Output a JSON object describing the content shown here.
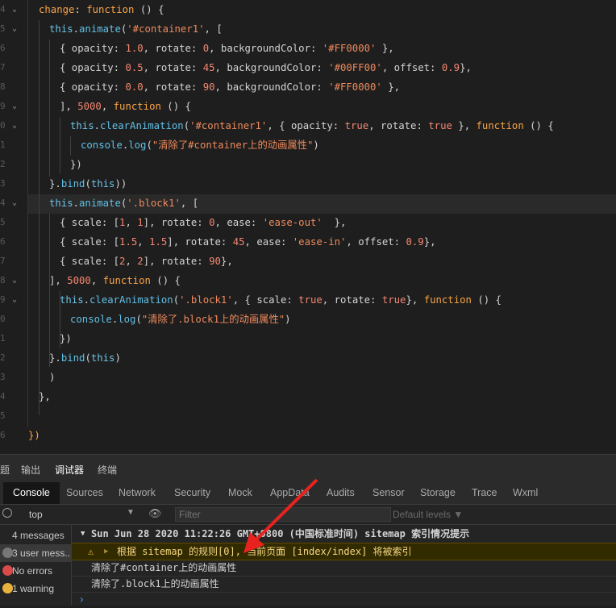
{
  "editor": {
    "lines": [
      {
        "num": "4",
        "fold": "v",
        "tokens": [
          [
            "kw",
            "change"
          ],
          [
            "p",
            ": "
          ],
          [
            "kw",
            "function"
          ],
          [
            "p",
            " () {"
          ]
        ]
      },
      {
        "num": "5",
        "fold": "v",
        "tokens": [
          [
            "th",
            "this"
          ],
          [
            "p",
            "."
          ],
          [
            "fn",
            "animate"
          ],
          [
            "p",
            "("
          ],
          [
            "str",
            "'#container1'"
          ],
          [
            "p",
            ", ["
          ]
        ]
      },
      {
        "num": "6",
        "fold": "",
        "tokens": [
          [
            "p",
            "{ opacity: "
          ],
          [
            "num",
            "1.0"
          ],
          [
            "p",
            ", rotate: "
          ],
          [
            "num",
            "0"
          ],
          [
            "p",
            ", backgroundColor: "
          ],
          [
            "str",
            "'#FF0000'"
          ],
          [
            "p",
            " },"
          ]
        ]
      },
      {
        "num": "7",
        "fold": "",
        "tokens": [
          [
            "p",
            "{ opacity: "
          ],
          [
            "num",
            "0.5"
          ],
          [
            "p",
            ", rotate: "
          ],
          [
            "num",
            "45"
          ],
          [
            "p",
            ", backgroundColor: "
          ],
          [
            "str",
            "'#00FF00'"
          ],
          [
            "p",
            ", offset: "
          ],
          [
            "num",
            "0.9"
          ],
          [
            "p",
            "},"
          ]
        ]
      },
      {
        "num": "8",
        "fold": "",
        "tokens": [
          [
            "p",
            "{ opacity: "
          ],
          [
            "num",
            "0.0"
          ],
          [
            "p",
            ", rotate: "
          ],
          [
            "num",
            "90"
          ],
          [
            "p",
            ", backgroundColor: "
          ],
          [
            "str",
            "'#FF0000'"
          ],
          [
            "p",
            " },"
          ]
        ]
      },
      {
        "num": "9",
        "fold": "v",
        "tokens": [
          [
            "p",
            "], "
          ],
          [
            "num",
            "5000"
          ],
          [
            "p",
            ", "
          ],
          [
            "kw",
            "function"
          ],
          [
            "p",
            " () {"
          ]
        ]
      },
      {
        "num": "0",
        "fold": "v",
        "tokens": [
          [
            "th",
            "this"
          ],
          [
            "p",
            "."
          ],
          [
            "fn",
            "clearAnimation"
          ],
          [
            "p",
            "("
          ],
          [
            "str",
            "'#container1'"
          ],
          [
            "p",
            ", { opacity: "
          ],
          [
            "bool",
            "true"
          ],
          [
            "p",
            ", rotate: "
          ],
          [
            "bool",
            "true"
          ],
          [
            "p",
            " }, "
          ],
          [
            "kw",
            "function"
          ],
          [
            "p",
            " () {"
          ]
        ]
      },
      {
        "num": "1",
        "fold": "",
        "tokens": [
          [
            "fn",
            "console"
          ],
          [
            "p",
            "."
          ],
          [
            "fn",
            "log"
          ],
          [
            "p",
            "("
          ],
          [
            "str",
            "\"清除了#container上的动画属性\""
          ],
          [
            "p",
            ")"
          ]
        ]
      },
      {
        "num": "2",
        "fold": "",
        "tokens": [
          [
            "p",
            "})"
          ]
        ]
      },
      {
        "num": "3",
        "fold": "",
        "tokens": [
          [
            "p",
            "}."
          ],
          [
            "fn",
            "bind"
          ],
          [
            "p",
            "("
          ],
          [
            "th",
            "this"
          ],
          [
            "p",
            "))"
          ]
        ]
      },
      {
        "num": "4",
        "fold": "v",
        "tokens": [
          [
            "th",
            "this"
          ],
          [
            "p",
            "."
          ],
          [
            "fn",
            "animate"
          ],
          [
            "p",
            "("
          ],
          [
            "str",
            "'.block1'"
          ],
          [
            "p",
            ", ["
          ]
        ]
      },
      {
        "num": "5",
        "fold": "",
        "tokens": [
          [
            "p",
            "{ scale: ["
          ],
          [
            "num",
            "1"
          ],
          [
            "p",
            ", "
          ],
          [
            "num",
            "1"
          ],
          [
            "p",
            "], rotate: "
          ],
          [
            "num",
            "0"
          ],
          [
            "p",
            ", ease: "
          ],
          [
            "str",
            "'ease-out'"
          ],
          [
            "p",
            "  },"
          ]
        ]
      },
      {
        "num": "6",
        "fold": "",
        "tokens": [
          [
            "p",
            "{ scale: ["
          ],
          [
            "num",
            "1.5"
          ],
          [
            "p",
            ", "
          ],
          [
            "num",
            "1.5"
          ],
          [
            "p",
            "], rotate: "
          ],
          [
            "num",
            "45"
          ],
          [
            "p",
            ", ease: "
          ],
          [
            "str",
            "'ease-in'"
          ],
          [
            "p",
            ", offset: "
          ],
          [
            "num",
            "0.9"
          ],
          [
            "p",
            "},"
          ]
        ]
      },
      {
        "num": "7",
        "fold": "",
        "tokens": [
          [
            "p",
            "{ scale: ["
          ],
          [
            "num",
            "2"
          ],
          [
            "p",
            ", "
          ],
          [
            "num",
            "2"
          ],
          [
            "p",
            "], rotate: "
          ],
          [
            "num",
            "90"
          ],
          [
            "p",
            "},"
          ]
        ]
      },
      {
        "num": "8",
        "fold": "v",
        "tokens": [
          [
            "p",
            "], "
          ],
          [
            "num",
            "5000"
          ],
          [
            "p",
            ", "
          ],
          [
            "kw",
            "function"
          ],
          [
            "p",
            " () {"
          ]
        ]
      },
      {
        "num": "9",
        "fold": "v",
        "tokens": [
          [
            "th",
            "this"
          ],
          [
            "p",
            "."
          ],
          [
            "fn",
            "clearAnimation"
          ],
          [
            "p",
            "("
          ],
          [
            "str",
            "'.block1'"
          ],
          [
            "p",
            ", { scale: "
          ],
          [
            "bool",
            "true"
          ],
          [
            "p",
            ", rotate: "
          ],
          [
            "bool",
            "true"
          ],
          [
            "p",
            "}, "
          ],
          [
            "kw",
            "function"
          ],
          [
            "p",
            " () {"
          ]
        ]
      },
      {
        "num": "0",
        "fold": "",
        "tokens": [
          [
            "fn",
            "console"
          ],
          [
            "p",
            "."
          ],
          [
            "fn",
            "log"
          ],
          [
            "p",
            "("
          ],
          [
            "str",
            "\"清除了.block1上的动画属性\""
          ],
          [
            "p",
            ")"
          ]
        ]
      },
      {
        "num": "1",
        "fold": "",
        "tokens": [
          [
            "p",
            "})"
          ]
        ]
      },
      {
        "num": "2",
        "fold": "",
        "tokens": [
          [
            "p",
            "}."
          ],
          [
            "fn",
            "bind"
          ],
          [
            "p",
            "("
          ],
          [
            "th",
            "this"
          ],
          [
            "p",
            ")"
          ]
        ]
      },
      {
        "num": "3",
        "fold": "",
        "tokens": [
          [
            "p",
            ")"
          ]
        ]
      },
      {
        "num": "4",
        "fold": "",
        "tokens": [
          [
            "p",
            "},"
          ]
        ]
      },
      {
        "num": "5",
        "fold": "",
        "tokens": []
      },
      {
        "num": "6",
        "fold": "",
        "tokens": [
          [
            "kw",
            "})"
          ]
        ]
      }
    ]
  },
  "top_tabs": [
    "题",
    "输出",
    "调试器",
    "终端"
  ],
  "devtools_tabs": [
    "Console",
    "Sources",
    "Network",
    "Security",
    "Mock",
    "AppData",
    "Audits",
    "Sensor",
    "Storage",
    "Trace",
    "Wxml"
  ],
  "toolbar": {
    "context": "top",
    "filter_placeholder": "Filter",
    "levels": "Default levels ▼"
  },
  "sidebar": [
    {
      "label": "4 messages",
      "icon": "list-icon",
      "color": "#7a7a7a"
    },
    {
      "label": "3 user mess...",
      "icon": "user-icon",
      "color": "#7a7a7a"
    },
    {
      "label": "No errors",
      "icon": "error-icon",
      "color": "#e05252"
    },
    {
      "label": "1 warning",
      "icon": "warning-icon",
      "color": "#e8b33a"
    }
  ],
  "console": {
    "group_header": "Sun Jun 28 2020 11:22:26 GMT+0800 (中国标准时间) sitemap 索引情况提示",
    "warning": "根据 sitemap 的规则[0], 当前页面 [index/index] 将被索引",
    "log1": "清除了#container上的动画属性",
    "log2": "清除了.block1上的动画属性",
    "prompt": "›"
  },
  "colors": {
    "accent": "#4d8ccc",
    "warning_bg": "#332b00",
    "arrow": "#e8231f"
  }
}
